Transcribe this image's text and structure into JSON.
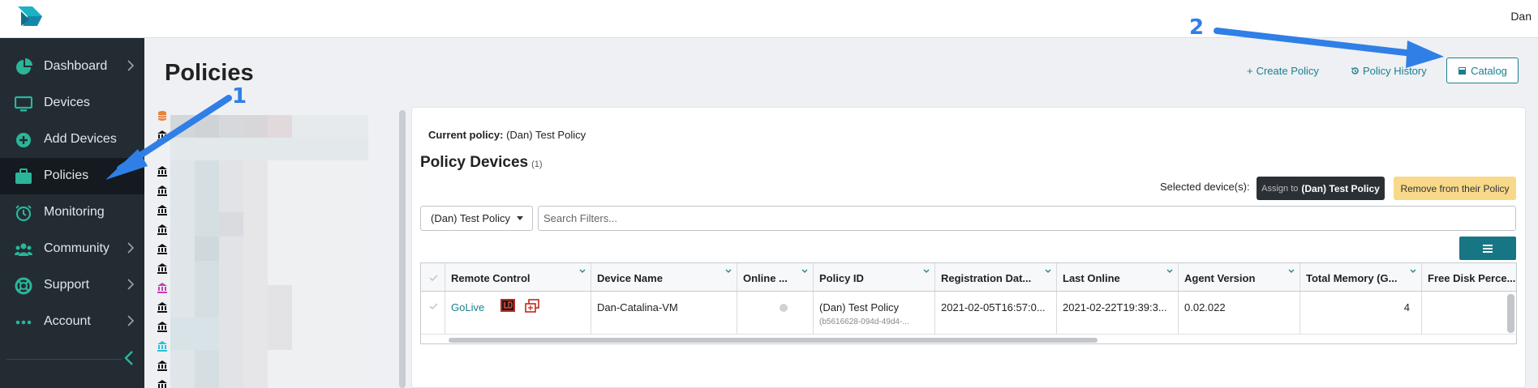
{
  "header": {
    "user_name": "Dan"
  },
  "sidebar": {
    "items": [
      {
        "label": "Dashboard",
        "icon": "pie-chart-icon",
        "has_submenu": true
      },
      {
        "label": "Devices",
        "icon": "monitor-icon",
        "has_submenu": false
      },
      {
        "label": "Add Devices",
        "icon": "plus-circle-icon",
        "has_submenu": false
      },
      {
        "label": "Policies",
        "icon": "briefcase-icon",
        "has_submenu": false,
        "active": true
      },
      {
        "label": "Monitoring",
        "icon": "alarm-clock-icon",
        "has_submenu": false
      },
      {
        "label": "Community",
        "icon": "users-icon",
        "has_submenu": true
      },
      {
        "label": "Support",
        "icon": "life-ring-icon",
        "has_submenu": true
      },
      {
        "label": "Account",
        "icon": "dots-icon",
        "has_submenu": true
      }
    ]
  },
  "page": {
    "title": "Policies",
    "actions": {
      "create": "Create Policy",
      "history": "Policy History",
      "catalog": "Catalog"
    }
  },
  "policy": {
    "current_label": "Current policy:",
    "current_value": "(Dan) Test Policy",
    "section_title": "Policy Devices",
    "section_count": "(1)",
    "selected_label": "Selected device(s):",
    "assign_prefix": "Assign to",
    "assign_target": "(Dan) Test Policy",
    "remove_label": "Remove from their Policy",
    "filter_select": "(Dan) Test Policy",
    "search_placeholder": "Search Filters..."
  },
  "grid": {
    "columns": [
      "Remote Control",
      "Device Name",
      "Online ...",
      "Policy ID",
      "Registration Dat...",
      "Last Online",
      "Agent Version",
      "Total Memory (G...",
      "Free Disk Perce..."
    ],
    "rows": [
      {
        "remote_control": "GoLive",
        "device_name": "Dan-Catalina-VM",
        "online": "offline",
        "policy_id": "(Dan) Test Policy",
        "policy_uuid": "(b5616628-094d-49d4-...",
        "registration_date": "2021-02-05T16:57:0...",
        "last_online": "2021-02-22T19:39:3...",
        "agent_version": "0.02.022",
        "total_memory": "4",
        "free_disk": ""
      }
    ]
  },
  "annotations": {
    "marker_1": "1",
    "marker_2": "2"
  },
  "colors": {
    "accent": "#1a7f8f",
    "sidebar_bg": "#232c33",
    "sidebar_icon": "#2bb59a",
    "annotation": "#2f7fe6",
    "warning_btn": "#f8d98a"
  }
}
